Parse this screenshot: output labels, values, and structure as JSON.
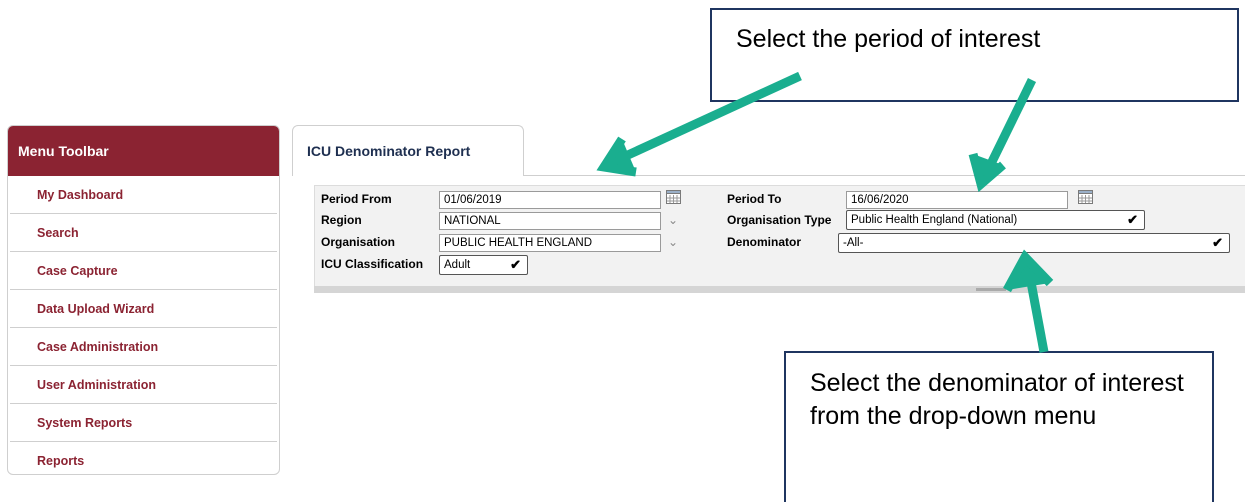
{
  "sidebar": {
    "title": "Menu Toolbar",
    "items": [
      {
        "label": "My Dashboard"
      },
      {
        "label": "Search"
      },
      {
        "label": "Case Capture"
      },
      {
        "label": "Data Upload Wizard"
      },
      {
        "label": "Case Administration"
      },
      {
        "label": "User Administration"
      },
      {
        "label": "System Reports"
      },
      {
        "label": "Reports"
      }
    ]
  },
  "tab": {
    "label": "ICU Denominator Report"
  },
  "form": {
    "period_from": {
      "label": "Period From",
      "value": "01/06/2019"
    },
    "period_to": {
      "label": "Period To",
      "value": "16/06/2020"
    },
    "region": {
      "label": "Region",
      "value": "NATIONAL"
    },
    "organisation_type": {
      "label": "Organisation Type",
      "value": "Public Health England (National)"
    },
    "organisation": {
      "label": "Organisation",
      "value": "PUBLIC HEALTH ENGLAND"
    },
    "denominator": {
      "label": "Denominator",
      "value": "-All-"
    },
    "icu_classification": {
      "label": "ICU Classification",
      "value": "Adult"
    }
  },
  "callouts": {
    "period": "Select the period of interest",
    "denominator": "Select the denominator of interest from the drop-down menu"
  },
  "colors": {
    "brand": "#8b2332",
    "arrow": "#1aae8f",
    "callout_border": "#1f3560"
  }
}
